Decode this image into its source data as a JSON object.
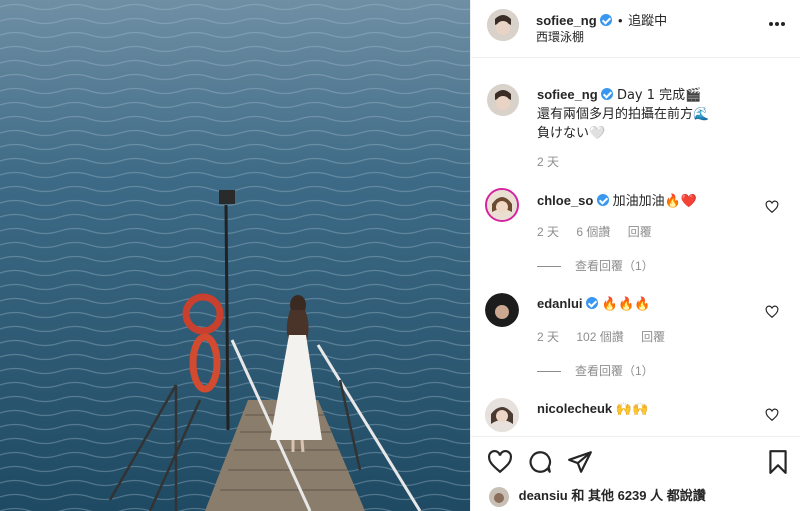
{
  "header": {
    "username": "sofiee_ng",
    "separator": "•",
    "follow_status": "追蹤中",
    "location": "西環泳棚",
    "more_icon": "more-horizontal-icon"
  },
  "caption": {
    "username": "sofiee_ng",
    "line1": "Day 1 完成🎬",
    "line2": "還有兩個多月的拍攝在前方🌊",
    "line3": "負けない🤍",
    "time": "2 天"
  },
  "comments": [
    {
      "username": "chloe_so",
      "text": "加油加油🔥❤️",
      "time": "2 天",
      "likes": "6 個讚",
      "reply": "回覆",
      "view_replies": "查看回覆（1）"
    },
    {
      "username": "edanlui",
      "text": "🔥🔥🔥",
      "time": "2 天",
      "likes": "102 個讚",
      "reply": "回覆",
      "view_replies": "查看回覆（1）"
    },
    {
      "username": "nicolecheuk",
      "text": "🙌🙌"
    }
  ],
  "actions": {
    "like_icon": "heart-icon",
    "comment_icon": "comment-icon",
    "share_icon": "share-icon",
    "save_icon": "bookmark-icon"
  },
  "likes_line": {
    "username": "deansiu",
    "text": "和 其他 6239 人 都說讚"
  },
  "colors": {
    "verified": "#3897f0",
    "secondary_text": "#8e8e8e",
    "divider": "#efefef",
    "sea": "#2f5a74"
  }
}
